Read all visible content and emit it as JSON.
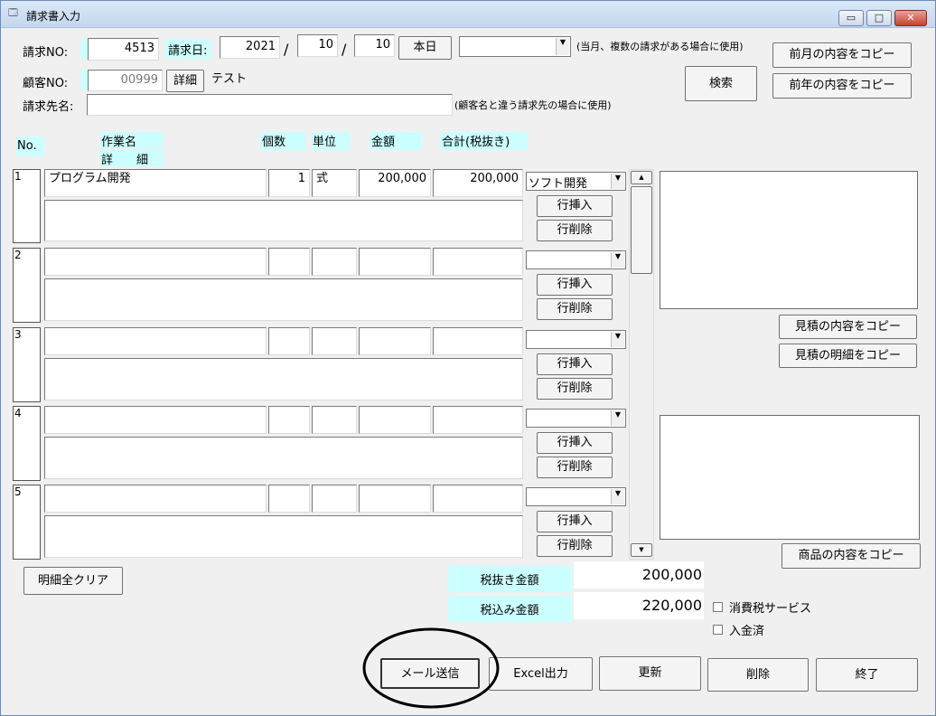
{
  "window": {
    "title": "請求書入力",
    "min": "▭",
    "max": "□",
    "close": "✕"
  },
  "header": {
    "invoice_no_label": "請求NO:",
    "invoice_no": "4513",
    "invoice_date_label": "請求日:",
    "year": "2021",
    "sep1": "/",
    "month": "10",
    "sep2": "/",
    "day": "10",
    "today_button": "本日",
    "period_select": "",
    "period_note": "(当月、複数の請求がある場合に使用)",
    "customer_no_label": "顧客NO:",
    "customer_no": "00999",
    "detail_button": "詳細",
    "customer_name": "テスト",
    "billing_name_label": "請求先名:",
    "billing_name": "",
    "billing_note": "(顧客名と違う請求先の場合に使用)",
    "search_button": "検索",
    "copy_prev_month": "前月の内容をコピー",
    "copy_prev_year": "前年の内容をコピー"
  },
  "columns": {
    "no": "No.",
    "work_name": "作業名",
    "detail": "詳　　細",
    "qty": "個数",
    "unit": "単位",
    "amount": "金額",
    "subtotal": "合計(税抜き)"
  },
  "rows": [
    {
      "no": "1",
      "name": "プログラム開発",
      "qty": "1",
      "unit": "式",
      "amount": "200,000",
      "subtotal": "200,000",
      "category": "ソフト開発",
      "detail": "",
      "insert": "行挿入",
      "delete": "行削除"
    },
    {
      "no": "2",
      "name": "",
      "qty": "",
      "unit": "",
      "amount": "",
      "subtotal": "",
      "category": "",
      "detail": "",
      "insert": "行挿入",
      "delete": "行削除"
    },
    {
      "no": "3",
      "name": "",
      "qty": "",
      "unit": "",
      "amount": "",
      "subtotal": "",
      "category": "",
      "detail": "",
      "insert": "行挿入",
      "delete": "行削除"
    },
    {
      "no": "4",
      "name": "",
      "qty": "",
      "unit": "",
      "amount": "",
      "subtotal": "",
      "category": "",
      "detail": "",
      "insert": "行挿入",
      "delete": "行削除"
    },
    {
      "no": "5",
      "name": "",
      "qty": "",
      "unit": "",
      "amount": "",
      "subtotal": "",
      "category": "",
      "detail": "",
      "insert": "行挿入",
      "delete": "行削除"
    }
  ],
  "scrollbar": {
    "up": "▲",
    "down": "▼"
  },
  "side": {
    "copy_estimate_content": "見積の内容をコピー",
    "copy_estimate_detail": "見積の明細をコピー",
    "copy_product_content": "商品の内容をコピー"
  },
  "totals": {
    "clear_button": "明細全クリア",
    "pretax_label": "税抜き金額",
    "pretax_value": "200,000",
    "taxin_label": "税込み金額",
    "taxin_value": "220,000",
    "tax_service": "消費税サービス",
    "paid": "入金済"
  },
  "footer": {
    "mail": "メール送信",
    "excel": "Excel出力",
    "update": "更新",
    "delete": "削除",
    "exit": "終了"
  }
}
